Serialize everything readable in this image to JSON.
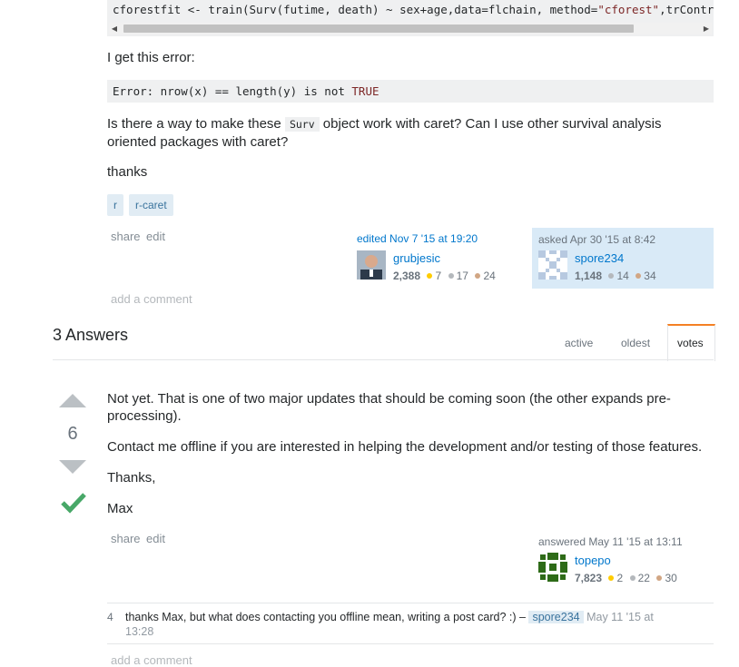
{
  "question": {
    "code_line": {
      "before": "cforestfit <- train(Surv(futime, death) ~ sex+age,data=flchain, method=",
      "string": "\"cforest\"",
      "after": ",trControl ="
    },
    "error_intro": "I get this error:",
    "error": {
      "before": "Error: nrow(x) == length(y) is not ",
      "keyword": "TRUE"
    },
    "question_text": {
      "part1": "Is there a way to make these ",
      "code": "Surv",
      "part2": " object work with caret? Can I use other survival analysis",
      "line2": "oriented packages with caret?"
    },
    "thanks": "thanks",
    "tags": [
      "r",
      "r-caret"
    ],
    "actions": {
      "share": "share",
      "edit": "edit"
    },
    "editor": {
      "action": "edited Nov 7 '15 at 19:20",
      "name": "grubjesic",
      "rep": "2,388",
      "gold": "7",
      "silver": "17",
      "bronze": "24"
    },
    "asker": {
      "action": "asked Apr 30 '15 at 8:42",
      "name": "spore234",
      "rep": "1,148",
      "silver": "14",
      "bronze": "34"
    },
    "add_comment": "add a comment"
  },
  "answers_header": {
    "title": "3 Answers",
    "tabs": {
      "active": "active",
      "oldest": "oldest",
      "votes": "votes"
    }
  },
  "answer": {
    "votes": "6",
    "paragraphs": {
      "p1a": "Not yet. That is one of two major updates that should be coming soon (the other expands pre-",
      "p1b": "processing).",
      "p2": "Contact me offline if you are interested in helping the development and/or testing of those features.",
      "p3": "Thanks,",
      "p4": "Max"
    },
    "actions": {
      "share": "share",
      "edit": "edit"
    },
    "author": {
      "action": "answered May 11 '15 at 13:11",
      "name": "topepo",
      "rep": "7,823",
      "gold": "2",
      "silver": "22",
      "bronze": "30"
    },
    "comment": {
      "score": "4",
      "text": "thanks Max, but what does contacting you offline mean, writing a post card? :) –",
      "user": "spore234",
      "date1": "May 11 '15 at",
      "date2": "13:28"
    },
    "add_comment": "add a comment"
  },
  "colors": {
    "link": "#0077cc",
    "accept": "#48a868",
    "tab_accent": "#f48024",
    "owner_bg": "#d9eaf7"
  }
}
